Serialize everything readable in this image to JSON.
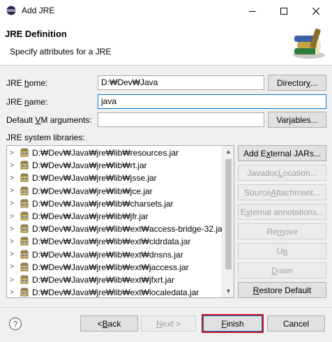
{
  "window": {
    "title": "Add JRE",
    "icons": {
      "app": "eclipse-icon",
      "minimize": "minimize-icon",
      "maximize": "maximize-icon",
      "close": "close-icon"
    }
  },
  "header": {
    "title": "JRE Definition",
    "description": "Specify attributes for a JRE",
    "banner_icon": "books-icon"
  },
  "form": {
    "jre_home": {
      "label_pre": "JRE ",
      "label_u": "h",
      "label_post": "ome:",
      "value": "D:₩Dev₩Java",
      "button_pre": "Director",
      "button_u": "y",
      "button_post": "..."
    },
    "jre_name": {
      "label_pre": "JRE ",
      "label_u": "n",
      "label_post": "ame:",
      "value": "java"
    },
    "vm_args": {
      "label_pre": "Default ",
      "label_u": "V",
      "label_post": "M arguments:",
      "value": "",
      "button_pre": "Var",
      "button_u": "i",
      "button_post": "ables..."
    },
    "libraries_label": "JRE system libraries:"
  },
  "libraries": [
    "D:₩Dev₩Java₩jre₩lib₩resources.jar",
    "D:₩Dev₩Java₩jre₩lib₩rt.jar",
    "D:₩Dev₩Java₩jre₩lib₩jsse.jar",
    "D:₩Dev₩Java₩jre₩lib₩jce.jar",
    "D:₩Dev₩Java₩jre₩lib₩charsets.jar",
    "D:₩Dev₩Java₩jre₩lib₩jfr.jar",
    "D:₩Dev₩Java₩jre₩lib₩ext₩access-bridge-32.jar",
    "D:₩Dev₩Java₩jre₩lib₩ext₩cldrdata.jar",
    "D:₩Dev₩Java₩jre₩lib₩ext₩dnsns.jar",
    "D:₩Dev₩Java₩jre₩lib₩ext₩jaccess.jar",
    "D:₩Dev₩Java₩jre₩lib₩ext₩jfxrt.jar",
    "D:₩Dev₩Java₩jre₩lib₩ext₩localedata.jar"
  ],
  "side_buttons": {
    "add_external": {
      "pre": "Add E",
      "u": "x",
      "post": "ternal JARs..."
    },
    "javadoc": {
      "pre": "Javadoc ",
      "u": "L",
      "post": "ocation..."
    },
    "source": {
      "pre": "Source ",
      "u": "A",
      "post": "ttachment..."
    },
    "external_annotations": {
      "pre": "E",
      "u": "x",
      "post": "ternal annotations..."
    },
    "remove": {
      "pre": "Re",
      "u": "m",
      "post": "ove"
    },
    "up": {
      "pre": "U",
      "u": "p",
      "post": ""
    },
    "down": {
      "pre": "",
      "u": "D",
      "post": "own"
    },
    "restore": {
      "pre": "",
      "u": "R",
      "post": "estore Default"
    }
  },
  "footer": {
    "help_icon": "help-icon",
    "back": {
      "pre": "< ",
      "u": "B",
      "post": "ack"
    },
    "next": {
      "pre": "",
      "u": "N",
      "post": "ext >"
    },
    "finish": {
      "pre": "",
      "u": "F",
      "post": "inish"
    },
    "cancel": "Cancel"
  },
  "colors": {
    "accent": "#0078d7",
    "finish_highlight": "#d40f1c"
  }
}
